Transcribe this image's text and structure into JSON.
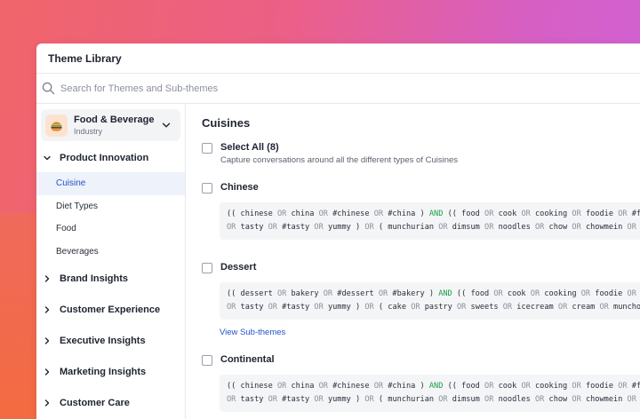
{
  "window": {
    "title": "Theme Library"
  },
  "search": {
    "placeholder": "Search for Themes and Sub-themes"
  },
  "sidebar": {
    "industry": {
      "name": "Food & Beverage",
      "type": "Industry",
      "icon": "burger-icon"
    },
    "groups": [
      {
        "label": "Product Innovation",
        "expanded": true,
        "items": [
          {
            "label": "Cuisine",
            "active": true
          },
          {
            "label": "Diet Types"
          },
          {
            "label": "Food"
          },
          {
            "label": "Beverages"
          }
        ]
      },
      {
        "label": "Brand Insights"
      },
      {
        "label": "Customer Experience"
      },
      {
        "label": "Executive Insights"
      },
      {
        "label": "Marketing Insights"
      },
      {
        "label": "Customer Care"
      }
    ]
  },
  "main": {
    "title": "Cuisines",
    "select_all": {
      "label": "Select All (8)",
      "description": "Capture conversations around all the different types of Cuisines"
    },
    "items": [
      {
        "label": "Chinese",
        "query_line1": "(( chinese OR china OR #chinese OR #china ) AND (( food OR cook OR cooking OR foodie OR #food",
        "query_line2": "OR tasty OR #tasty OR yummy ) OR ( munchurian OR dimsum OR noodles OR chow OR chowmein OR mo"
      },
      {
        "label": "Dessert",
        "query_line1": "(( dessert OR bakery OR #dessert OR #bakery ) AND (( food OR cook OR cooking OR foodie OR #f",
        "query_line2": "OR tasty OR #tasty OR yummy ) OR ( cake OR pastry OR sweets OR icecream OR cream OR munchow",
        "link": "View Sub-themes"
      },
      {
        "label": "Continental",
        "query_line1": "(( chinese OR china OR #chinese OR #china ) AND (( food OR cook OR cooking OR foodie OR #food",
        "query_line2": "OR tasty OR #tasty OR yummy ) OR ( munchurian OR dimsum OR noodles OR chow OR chowmein OR mo"
      }
    ]
  },
  "colors": {
    "accent": "#2152c9",
    "and_operator": "#1d9e47",
    "or_operator": "#8a909c"
  }
}
